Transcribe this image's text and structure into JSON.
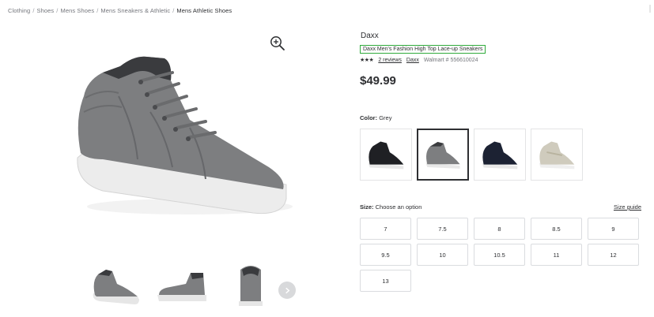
{
  "breadcrumb": {
    "items": [
      "Clothing",
      "Shoes",
      "Mens Shoes",
      "Mens Sneakers & Athletic",
      "Mens Athletic Shoes"
    ],
    "separator": "/"
  },
  "product": {
    "brand": "Daxx",
    "title": "Daxx Men's Fashion High Top Lace-up Sneakers",
    "rating_stars": "★★★",
    "reviews_label": "2 reviews",
    "brand_link": "Daxx",
    "walmart_number": "Walmart # 556610024",
    "price": "$49.99"
  },
  "color": {
    "label": "Color:",
    "selected": "Grey",
    "options": [
      {
        "name": "black-sneaker",
        "color": "#1f2024"
      },
      {
        "name": "grey-sneaker",
        "color": "#7d7e80"
      },
      {
        "name": "navy-sneaker",
        "color": "#1c2233"
      },
      {
        "name": "cream-sneaker",
        "color": "#cfcbbd"
      }
    ]
  },
  "size": {
    "label": "Size:",
    "prompt": "Choose an option",
    "guide_label": "Size guide",
    "options": [
      "7",
      "7.5",
      "8",
      "8.5",
      "9",
      "9.5",
      "10",
      "10.5",
      "11",
      "12",
      "13"
    ]
  },
  "icons": {
    "zoom": "zoom-in-icon",
    "next": "chevron-right-icon"
  },
  "colors": {
    "highlight_border": "#2eaa3b",
    "shoe_grey": "#7d7e80",
    "sole_white": "#ececec"
  }
}
